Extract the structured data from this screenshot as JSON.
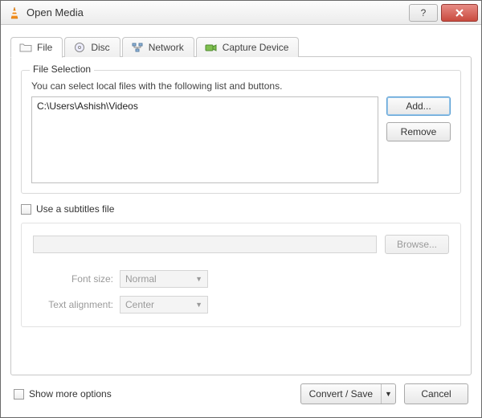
{
  "window": {
    "title": "Open Media"
  },
  "tabs": {
    "file": "File",
    "disc": "Disc",
    "network": "Network",
    "capture": "Capture Device"
  },
  "file_selection": {
    "legend": "File Selection",
    "hint": "You can select local files with the following list and buttons.",
    "items": [
      "C:\\Users\\Ashish\\Videos"
    ],
    "add_label": "Add...",
    "remove_label": "Remove"
  },
  "subtitles": {
    "checkbox_label": "Use a subtitles file",
    "browse_label": "Browse...",
    "font_size_label": "Font size:",
    "font_size_value": "Normal",
    "text_align_label": "Text alignment:",
    "text_align_value": "Center"
  },
  "footer": {
    "show_more_label": "Show more options",
    "convert_label": "Convert / Save",
    "cancel_label": "Cancel"
  }
}
